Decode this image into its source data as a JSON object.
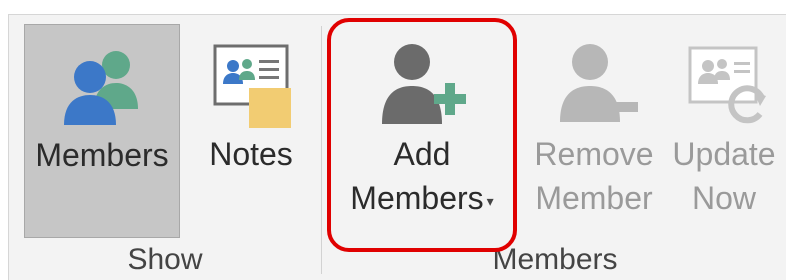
{
  "groups": {
    "show": {
      "label": "Show",
      "buttons": [
        {
          "label": "Members",
          "icon": "members-icon",
          "selected": true
        },
        {
          "label": "Notes",
          "icon": "notes-icon",
          "selected": false
        }
      ]
    },
    "members": {
      "label": "Members",
      "buttons": [
        {
          "label_line1": "Add",
          "label_line2": "Members",
          "icon": "add-member-icon",
          "has_dropdown": true
        },
        {
          "label_line1": "Remove",
          "label_line2": "Member",
          "icon": "remove-member-icon",
          "disabled": true
        },
        {
          "label_line1": "Update",
          "label_line2": "Now",
          "icon": "update-now-icon",
          "disabled": true
        }
      ]
    }
  },
  "colors": {
    "highlight": "#e00000",
    "accent_blue": "#3c78c8",
    "accent_green": "#5fa88a",
    "sticky_yellow": "#f2cc72"
  }
}
